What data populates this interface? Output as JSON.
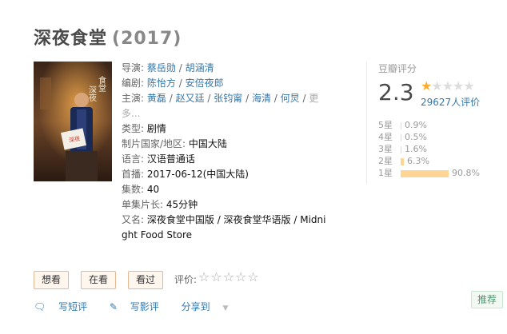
{
  "title": "深夜食堂",
  "year": "(2017)",
  "info": {
    "director_label": "导演:",
    "directors": [
      "蔡岳勋",
      "胡涵清"
    ],
    "writer_label": "编剧:",
    "writers": [
      "陈怡方",
      "安倍夜郎"
    ],
    "cast_label": "主演:",
    "cast": [
      "黄磊",
      "赵又廷",
      "张钧甯",
      "海清",
      "何炅"
    ],
    "cast_more": "更多...",
    "genre_label": "类型:",
    "genre": "剧情",
    "country_label": "制片国家/地区:",
    "country": "中国大陆",
    "language_label": "语言:",
    "language": "汉语普通话",
    "premiere_label": "首播:",
    "premiere": "2017-06-12(中国大陆)",
    "episodes_label": "集数:",
    "episodes": "40",
    "duration_label": "单集片长:",
    "duration": "45分钟",
    "aka_label": "又名:",
    "aka": "深夜食堂中国版 / 深夜食堂华语版 / Midnight Food Store"
  },
  "rating": {
    "label": "豆瓣评分",
    "score": "2.3",
    "stars": 1,
    "votes": "29627人评价",
    "distribution": [
      {
        "label": "5星",
        "pct": "0.9%",
        "value": 0.9
      },
      {
        "label": "4星",
        "pct": "0.5%",
        "value": 0.5
      },
      {
        "label": "3星",
        "pct": "1.6%",
        "value": 1.6
      },
      {
        "label": "2星",
        "pct": "6.3%",
        "value": 6.3
      },
      {
        "label": "1星",
        "pct": "90.8%",
        "value": 90.8
      }
    ]
  },
  "actions": {
    "want": "想看",
    "watching": "在看",
    "watched": "看过",
    "rate_label": "评价:"
  },
  "links": {
    "short_review": "写短评",
    "review": "写影评",
    "share": "分享到"
  },
  "recommend": "推荐",
  "colors": {
    "star": "#ffac2d",
    "bar": "#ffd596",
    "link": "#3377aa",
    "button_bg": "#fff6ee",
    "recommend_text": "#4f946e"
  }
}
